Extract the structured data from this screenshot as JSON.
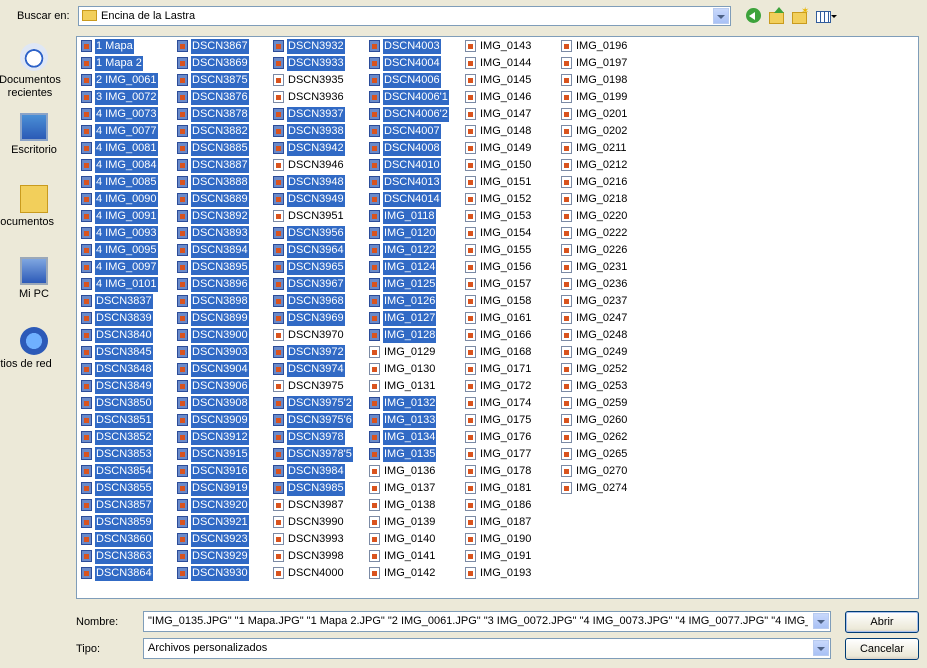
{
  "lookin": {
    "label": "Buscar en:",
    "value": "Encina de la Lastra"
  },
  "places": [
    {
      "label": "Documentos\nrecientes",
      "icon": "recent-documents-icon"
    },
    {
      "label": "Escritorio",
      "icon": "desktop-icon"
    },
    {
      "label": "Mis documentos",
      "icon": "my-documents-icon"
    },
    {
      "label": "Mi PC",
      "icon": "my-computer-icon"
    },
    {
      "label": "Mis sitios de red",
      "icon": "network-places-icon"
    }
  ],
  "columns": [
    [
      {
        "n": "1 Mapa",
        "s": true
      },
      {
        "n": "1 Mapa 2",
        "s": true
      },
      {
        "n": "2 IMG_0061",
        "s": true
      },
      {
        "n": "3 IMG_0072",
        "s": true
      },
      {
        "n": "4 IMG_0073",
        "s": true
      },
      {
        "n": "4 IMG_0077",
        "s": true
      },
      {
        "n": "4 IMG_0081",
        "s": true
      },
      {
        "n": "4 IMG_0084",
        "s": true
      },
      {
        "n": "4 IMG_0085",
        "s": true
      },
      {
        "n": "4 IMG_0090",
        "s": true
      },
      {
        "n": "4 IMG_0091",
        "s": true
      },
      {
        "n": "4 IMG_0093",
        "s": true
      },
      {
        "n": "4 IMG_0095",
        "s": true
      },
      {
        "n": "4 IMG_0097",
        "s": true
      },
      {
        "n": "4 IMG_0101",
        "s": true
      },
      {
        "n": "DSCN3837",
        "s": true
      },
      {
        "n": "DSCN3839",
        "s": true
      },
      {
        "n": "DSCN3840",
        "s": true
      },
      {
        "n": "DSCN3845",
        "s": true
      },
      {
        "n": "DSCN3848",
        "s": true
      },
      {
        "n": "DSCN3849",
        "s": true
      },
      {
        "n": "DSCN3850",
        "s": true
      },
      {
        "n": "DSCN3851",
        "s": true
      },
      {
        "n": "DSCN3852",
        "s": true
      },
      {
        "n": "DSCN3853",
        "s": true
      },
      {
        "n": "DSCN3854",
        "s": true
      },
      {
        "n": "DSCN3855",
        "s": true
      },
      {
        "n": "DSCN3857",
        "s": true
      },
      {
        "n": "DSCN3859",
        "s": true
      },
      {
        "n": "DSCN3860",
        "s": true
      },
      {
        "n": "DSCN3863",
        "s": true
      },
      {
        "n": "DSCN3864",
        "s": true
      }
    ],
    [
      {
        "n": "DSCN3867",
        "s": true
      },
      {
        "n": "DSCN3869",
        "s": true
      },
      {
        "n": "DSCN3875",
        "s": true
      },
      {
        "n": "DSCN3876",
        "s": true
      },
      {
        "n": "DSCN3878",
        "s": true
      },
      {
        "n": "DSCN3882",
        "s": true
      },
      {
        "n": "DSCN3885",
        "s": true
      },
      {
        "n": "DSCN3887",
        "s": true
      },
      {
        "n": "DSCN3888",
        "s": true
      },
      {
        "n": "DSCN3889",
        "s": true
      },
      {
        "n": "DSCN3892",
        "s": true
      },
      {
        "n": "DSCN3893",
        "s": true
      },
      {
        "n": "DSCN3894",
        "s": true
      },
      {
        "n": "DSCN3895",
        "s": true
      },
      {
        "n": "DSCN3896",
        "s": true
      },
      {
        "n": "DSCN3898",
        "s": true
      },
      {
        "n": "DSCN3899",
        "s": true
      },
      {
        "n": "DSCN3900",
        "s": true
      },
      {
        "n": "DSCN3903",
        "s": true
      },
      {
        "n": "DSCN3904",
        "s": true
      },
      {
        "n": "DSCN3906",
        "s": true
      },
      {
        "n": "DSCN3908",
        "s": true
      },
      {
        "n": "DSCN3909",
        "s": true
      },
      {
        "n": "DSCN3912",
        "s": true
      },
      {
        "n": "DSCN3915",
        "s": true
      },
      {
        "n": "DSCN3916",
        "s": true
      },
      {
        "n": "DSCN3919",
        "s": true
      },
      {
        "n": "DSCN3920",
        "s": true
      },
      {
        "n": "DSCN3921",
        "s": true
      },
      {
        "n": "DSCN3923",
        "s": true
      },
      {
        "n": "DSCN3929",
        "s": true
      },
      {
        "n": "DSCN3930",
        "s": true
      }
    ],
    [
      {
        "n": "DSCN3932",
        "s": true
      },
      {
        "n": "DSCN3933",
        "s": true
      },
      {
        "n": "DSCN3935",
        "s": false
      },
      {
        "n": "DSCN3936",
        "s": false
      },
      {
        "n": "DSCN3937",
        "s": true
      },
      {
        "n": "DSCN3938",
        "s": true
      },
      {
        "n": "DSCN3942",
        "s": true
      },
      {
        "n": "DSCN3946",
        "s": false
      },
      {
        "n": "DSCN3948",
        "s": true
      },
      {
        "n": "DSCN3949",
        "s": true
      },
      {
        "n": "DSCN3951",
        "s": false
      },
      {
        "n": "DSCN3956",
        "s": true
      },
      {
        "n": "DSCN3964",
        "s": true
      },
      {
        "n": "DSCN3965",
        "s": true
      },
      {
        "n": "DSCN3967",
        "s": true
      },
      {
        "n": "DSCN3968",
        "s": true
      },
      {
        "n": "DSCN3969",
        "s": true
      },
      {
        "n": "DSCN3970",
        "s": false
      },
      {
        "n": "DSCN3972",
        "s": true
      },
      {
        "n": "DSCN3974",
        "s": true
      },
      {
        "n": "DSCN3975",
        "s": false
      },
      {
        "n": "DSCN3975'2",
        "s": true
      },
      {
        "n": "DSCN3975'6",
        "s": true
      },
      {
        "n": "DSCN3978",
        "s": true
      },
      {
        "n": "DSCN3978'5",
        "s": true
      },
      {
        "n": "DSCN3984",
        "s": true
      },
      {
        "n": "DSCN3985",
        "s": true
      },
      {
        "n": "DSCN3987",
        "s": false
      },
      {
        "n": "DSCN3990",
        "s": false
      },
      {
        "n": "DSCN3993",
        "s": false
      },
      {
        "n": "DSCN3998",
        "s": false
      },
      {
        "n": "DSCN4000",
        "s": false
      }
    ],
    [
      {
        "n": "DSCN4003",
        "s": true
      },
      {
        "n": "DSCN4004",
        "s": true
      },
      {
        "n": "DSCN4006",
        "s": true
      },
      {
        "n": "DSCN4006'1",
        "s": true
      },
      {
        "n": "DSCN4006'2",
        "s": true
      },
      {
        "n": "DSCN4007",
        "s": true
      },
      {
        "n": "DSCN4008",
        "s": true
      },
      {
        "n": "DSCN4010",
        "s": true
      },
      {
        "n": "DSCN4013",
        "s": true
      },
      {
        "n": "DSCN4014",
        "s": true
      },
      {
        "n": "IMG_0118",
        "s": true
      },
      {
        "n": "IMG_0120",
        "s": true
      },
      {
        "n": "IMG_0122",
        "s": true
      },
      {
        "n": "IMG_0124",
        "s": true
      },
      {
        "n": "IMG_0125",
        "s": true
      },
      {
        "n": "IMG_0126",
        "s": true
      },
      {
        "n": "IMG_0127",
        "s": true
      },
      {
        "n": "IMG_0128",
        "s": true
      },
      {
        "n": "IMG_0129",
        "s": false
      },
      {
        "n": "IMG_0130",
        "s": false
      },
      {
        "n": "IMG_0131",
        "s": false
      },
      {
        "n": "IMG_0132",
        "s": true
      },
      {
        "n": "IMG_0133",
        "s": true
      },
      {
        "n": "IMG_0134",
        "s": true
      },
      {
        "n": "IMG_0135",
        "s": true
      },
      {
        "n": "IMG_0136",
        "s": false
      },
      {
        "n": "IMG_0137",
        "s": false
      },
      {
        "n": "IMG_0138",
        "s": false
      },
      {
        "n": "IMG_0139",
        "s": false
      },
      {
        "n": "IMG_0140",
        "s": false
      },
      {
        "n": "IMG_0141",
        "s": false
      },
      {
        "n": "IMG_0142",
        "s": false
      }
    ],
    [
      {
        "n": "IMG_0143",
        "s": false
      },
      {
        "n": "IMG_0144",
        "s": false
      },
      {
        "n": "IMG_0145",
        "s": false
      },
      {
        "n": "IMG_0146",
        "s": false
      },
      {
        "n": "IMG_0147",
        "s": false
      },
      {
        "n": "IMG_0148",
        "s": false
      },
      {
        "n": "IMG_0149",
        "s": false
      },
      {
        "n": "IMG_0150",
        "s": false
      },
      {
        "n": "IMG_0151",
        "s": false
      },
      {
        "n": "IMG_0152",
        "s": false
      },
      {
        "n": "IMG_0153",
        "s": false
      },
      {
        "n": "IMG_0154",
        "s": false
      },
      {
        "n": "IMG_0155",
        "s": false
      },
      {
        "n": "IMG_0156",
        "s": false
      },
      {
        "n": "IMG_0157",
        "s": false
      },
      {
        "n": "IMG_0158",
        "s": false
      },
      {
        "n": "IMG_0161",
        "s": false
      },
      {
        "n": "IMG_0166",
        "s": false
      },
      {
        "n": "IMG_0168",
        "s": false
      },
      {
        "n": "IMG_0171",
        "s": false
      },
      {
        "n": "IMG_0172",
        "s": false
      },
      {
        "n": "IMG_0174",
        "s": false
      },
      {
        "n": "IMG_0175",
        "s": false
      },
      {
        "n": "IMG_0176",
        "s": false
      },
      {
        "n": "IMG_0177",
        "s": false
      },
      {
        "n": "IMG_0178",
        "s": false
      },
      {
        "n": "IMG_0181",
        "s": false
      },
      {
        "n": "IMG_0186",
        "s": false
      },
      {
        "n": "IMG_0187",
        "s": false
      },
      {
        "n": "IMG_0190",
        "s": false
      },
      {
        "n": "IMG_0191",
        "s": false
      },
      {
        "n": "IMG_0193",
        "s": false
      }
    ],
    [
      {
        "n": "IMG_0196",
        "s": false
      },
      {
        "n": "IMG_0197",
        "s": false
      },
      {
        "n": "IMG_0198",
        "s": false
      },
      {
        "n": "IMG_0199",
        "s": false
      },
      {
        "n": "IMG_0201",
        "s": false
      },
      {
        "n": "IMG_0202",
        "s": false
      },
      {
        "n": "IMG_0211",
        "s": false
      },
      {
        "n": "IMG_0212",
        "s": false
      },
      {
        "n": "IMG_0216",
        "s": false
      },
      {
        "n": "IMG_0218",
        "s": false
      },
      {
        "n": "IMG_0220",
        "s": false
      },
      {
        "n": "IMG_0222",
        "s": false
      },
      {
        "n": "IMG_0226",
        "s": false
      },
      {
        "n": "IMG_0231",
        "s": false
      },
      {
        "n": "IMG_0236",
        "s": false
      },
      {
        "n": "IMG_0237",
        "s": false
      },
      {
        "n": "IMG_0247",
        "s": false
      },
      {
        "n": "IMG_0248",
        "s": false
      },
      {
        "n": "IMG_0249",
        "s": false
      },
      {
        "n": "IMG_0252",
        "s": false
      },
      {
        "n": "IMG_0253",
        "s": false
      },
      {
        "n": "IMG_0259",
        "s": false
      },
      {
        "n": "IMG_0260",
        "s": false
      },
      {
        "n": "IMG_0262",
        "s": false
      },
      {
        "n": "IMG_0265",
        "s": false
      },
      {
        "n": "IMG_0270",
        "s": false
      },
      {
        "n": "IMG_0274",
        "s": false
      }
    ]
  ],
  "filename": {
    "label": "Nombre:",
    "value": "\"IMG_0135.JPG\" \"1 Mapa.JPG\" \"1 Mapa 2.JPG\" \"2 IMG_0061.JPG\" \"3 IMG_0072.JPG\" \"4 IMG_0073.JPG\" \"4 IMG_0077.JPG\" \"4 IMG_"
  },
  "filetype": {
    "label": "Tipo:",
    "value": "Archivos personalizados"
  },
  "buttons": {
    "open": "Abrir",
    "cancel": "Cancelar"
  }
}
